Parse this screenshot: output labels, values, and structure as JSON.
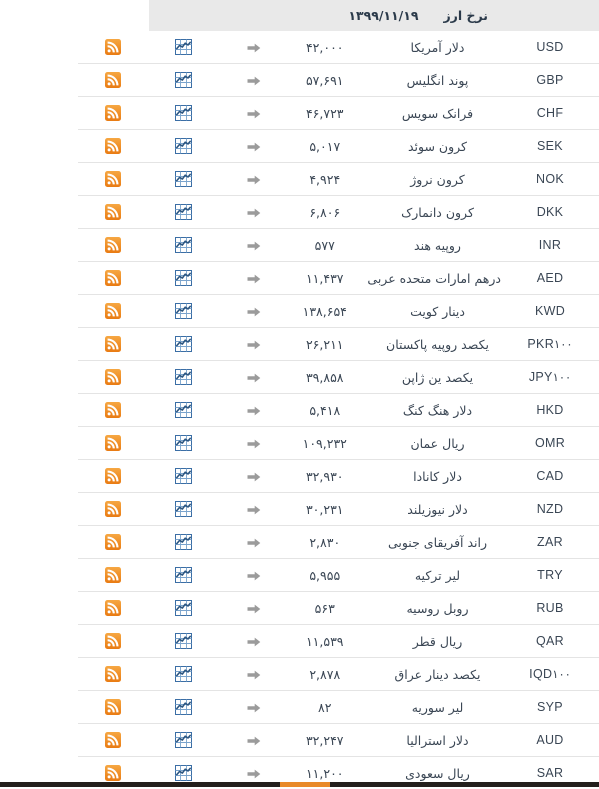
{
  "header": {
    "code_label": "",
    "title": "نرخ ارز",
    "date": "۱۳۹۹/۱۱/۱۹"
  },
  "icons": {
    "rss": "rss-icon",
    "chart": "chart-icon",
    "arrow": "arrow-right-icon"
  },
  "colors": {
    "rss_orange": "#ee8a22",
    "chart_blue": "#3b6ea5",
    "arrow_gray": "#9b9b9b",
    "header_bg": "#e9e9e9",
    "text": "#3a4654",
    "row_border": "#e4e4e4",
    "bottom_bar": "#231f1c",
    "bottom_accent": "#e98a28"
  },
  "rows": [
    {
      "code": "USD",
      "suffix": "",
      "name": "دلار آمریکا",
      "value": "۴۲,۰۰۰"
    },
    {
      "code": "GBP",
      "suffix": "",
      "name": "پوند انگلیس",
      "value": "۵۷,۶۹۱"
    },
    {
      "code": "CHF",
      "suffix": "",
      "name": "فرانک سویس",
      "value": "۴۶,۷۲۳"
    },
    {
      "code": "SEK",
      "suffix": "",
      "name": "کرون سوئد",
      "value": "۵,۰۱۷"
    },
    {
      "code": "NOK",
      "suffix": "",
      "name": "کرون نروژ",
      "value": "۴,۹۲۴"
    },
    {
      "code": "DKK",
      "suffix": "",
      "name": "کرون دانمارک",
      "value": "۶,۸۰۶"
    },
    {
      "code": "INR",
      "suffix": "",
      "name": "روپیه هند",
      "value": "۵۷۷"
    },
    {
      "code": "AED",
      "suffix": "",
      "name": "درهم امارات متحده عربی",
      "value": "۱۱,۴۳۷"
    },
    {
      "code": "KWD",
      "suffix": "",
      "name": "دینار کویت",
      "value": "۱۳۸,۶۵۴"
    },
    {
      "code": "PKR",
      "suffix": "۱۰۰",
      "name": "یکصد روپیه پاکستان",
      "value": "۲۶,۲۱۱"
    },
    {
      "code": "JPY",
      "suffix": "۱۰۰",
      "name": "یکصد ین ژاپن",
      "value": "۳۹,۸۵۸"
    },
    {
      "code": "HKD",
      "suffix": "",
      "name": "دلار هنگ کنگ",
      "value": "۵,۴۱۸"
    },
    {
      "code": "OMR",
      "suffix": "",
      "name": "ریال عمان",
      "value": "۱۰۹,۲۳۲"
    },
    {
      "code": "CAD",
      "suffix": "",
      "name": "دلار کانادا",
      "value": "۳۲,۹۳۰"
    },
    {
      "code": "NZD",
      "suffix": "",
      "name": "دلار نیوزیلند",
      "value": "۳۰,۲۳۱"
    },
    {
      "code": "ZAR",
      "suffix": "",
      "name": "راند آفریقای جنوبی",
      "value": "۲,۸۳۰"
    },
    {
      "code": "TRY",
      "suffix": "",
      "name": "لیر ترکیه",
      "value": "۵,۹۵۵"
    },
    {
      "code": "RUB",
      "suffix": "",
      "name": "روبل روسیه",
      "value": "۵۶۳"
    },
    {
      "code": "QAR",
      "suffix": "",
      "name": "ریال قطر",
      "value": "۱۱,۵۳۹"
    },
    {
      "code": "IQD",
      "suffix": "۱۰۰",
      "name": "یکصد دینار عراق",
      "value": "۲,۸۷۸"
    },
    {
      "code": "SYP",
      "suffix": "",
      "name": "لیر سوریه",
      "value": "۸۲"
    },
    {
      "code": "AUD",
      "suffix": "",
      "name": "دلار استرالیا",
      "value": "۳۲,۲۴۷"
    },
    {
      "code": "SAR",
      "suffix": "",
      "name": "ریال سعودی",
      "value": "۱۱,۲۰۰"
    }
  ]
}
